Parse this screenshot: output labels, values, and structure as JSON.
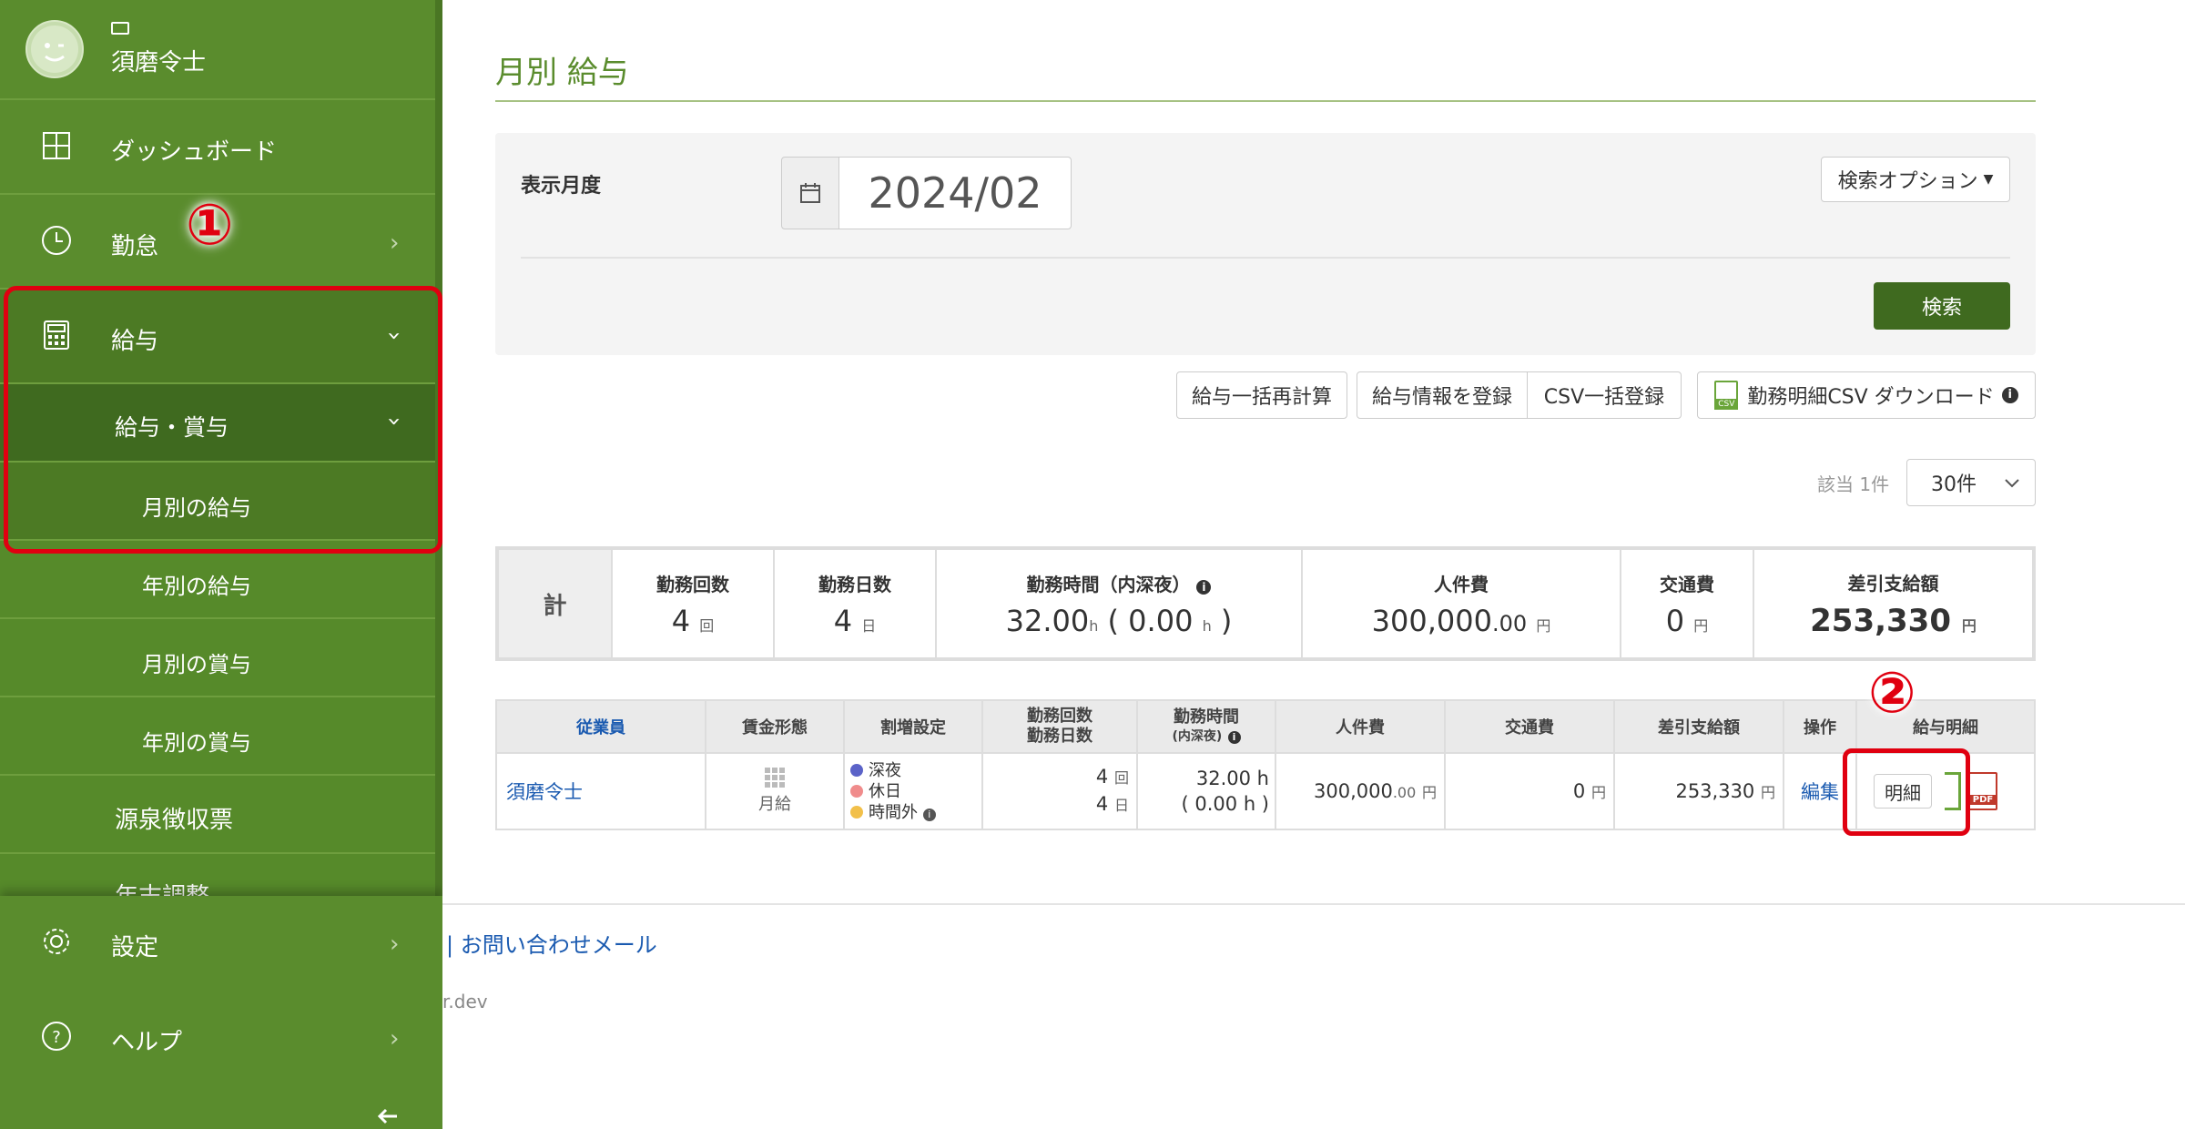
{
  "sidebar": {
    "user_name": "須磨令士",
    "items": [
      {
        "label": "ダッシュボード"
      },
      {
        "label": "勤怠"
      },
      {
        "label": "給与"
      },
      {
        "label": "給与・賞与"
      },
      {
        "label": "月別の給与"
      },
      {
        "label": "年別の給与"
      },
      {
        "label": "月別の賞与"
      },
      {
        "label": "年別の賞与"
      },
      {
        "label": "源泉徴収票"
      },
      {
        "label": "年末調整"
      }
    ],
    "bottom": [
      {
        "label": "設定"
      },
      {
        "label": "ヘルプ"
      }
    ],
    "collapse_icon": "arrow-left-icon"
  },
  "annotations": {
    "one": "①",
    "two": "②",
    "color": "#e00010"
  },
  "page": {
    "title": "月別 給与"
  },
  "search": {
    "month_label": "表示月度",
    "month_value": "2024/02",
    "options_button": "検索オプション",
    "search_button": "検索"
  },
  "actions": {
    "recalc": "給与一括再計算",
    "register": "給与情報を登録",
    "csv_register": "CSV一括登録",
    "csv_download": "勤務明細CSV ダウンロード",
    "csv_icon_text": "CSV"
  },
  "pagination": {
    "count_text": "該当 1件",
    "per_page": "30件"
  },
  "summary": {
    "label": "計",
    "work_count_label": "勤務回数",
    "work_count": "4",
    "work_count_unit": "回",
    "work_days_label": "勤務日数",
    "work_days": "4",
    "work_days_unit": "日",
    "work_hours_label": "勤務時間（内深夜）",
    "work_hours": "32.00",
    "night_hours": "0.00",
    "hour_unit": "h",
    "labor_cost_label": "人件費",
    "labor_cost": "300,000",
    "labor_cost_dec": ".00",
    "yen": "円",
    "transport_label": "交通費",
    "transport": "0",
    "net_pay_label": "差引支給額",
    "net_pay": "253,330"
  },
  "table": {
    "headers": {
      "employee": "従業員",
      "wage_type": "賃金形態",
      "surcharge": "割増設定",
      "count_days_1": "勤務回数",
      "count_days_2": "勤務日数",
      "hours_1": "勤務時間",
      "hours_2": "(内深夜)",
      "labor_cost": "人件費",
      "transport": "交通費",
      "net_pay": "差引支給額",
      "operation": "操作",
      "statement": "給与明細"
    },
    "row": {
      "employee": "須磨令士",
      "wage_type": "月給",
      "surcharges": [
        {
          "label": "深夜",
          "color": "#5b63c8"
        },
        {
          "label": "休日",
          "color": "#f08c8c"
        },
        {
          "label": "時間外",
          "color": "#f2c04a"
        }
      ],
      "work_count": "4",
      "count_unit": "回",
      "work_days": "4",
      "days_unit": "日",
      "hours": "32.00 h",
      "night_hours": "( 0.00 h )",
      "labor_cost": "300,000",
      "labor_cost_dec": ".00",
      "yen": "円",
      "transport": "0",
      "net_pay": "253,330",
      "edit": "編集",
      "detail_button": "明細",
      "pdf_text": "PDF"
    }
  },
  "footer": {
    "link": "| お問い合わせメール",
    "domain": "r.dev"
  },
  "colors": {
    "sidebar": "#5a8c2d",
    "accent": "#3f6a1f",
    "link": "#1a5ab0"
  }
}
